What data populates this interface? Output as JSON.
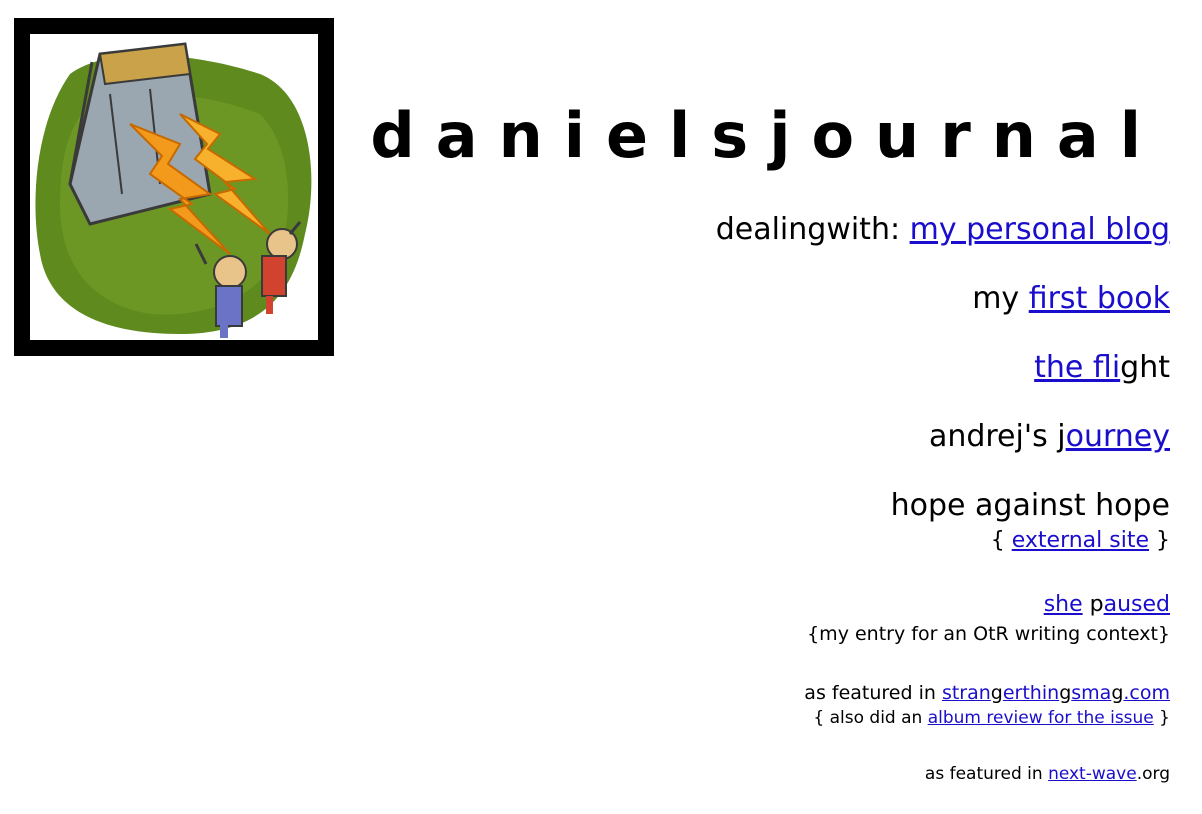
{
  "site": {
    "title": "danielsjournal"
  },
  "links": {
    "blog": {
      "prefix": "dealingwith: ",
      "link": "my personal blog"
    },
    "book": {
      "prefix": "my ",
      "link": "first book"
    },
    "flight": {
      "link": "the fli",
      "suffix": "ght"
    },
    "journey": {
      "prefix": "andrej's j",
      "link": "ourney"
    },
    "hope": {
      "title": "hope against hope",
      "open": "{ ",
      "link": "external site",
      "close": " }"
    },
    "paused": {
      "link1": "she",
      "mid": " p",
      "link2": "aused",
      "note": "{my entry for an OtR writing context}"
    },
    "strangerthings": {
      "prefix": "as featured in ",
      "seg1": "stran",
      "seg2": "g",
      "seg3": "erthin",
      "seg4": "g",
      "seg5": "sma",
      "seg6": "g",
      "seg7": ".com",
      "note_prefix": "{ also did an ",
      "note_link": "album review for the issue",
      "note_suffix": " }"
    },
    "nextwave": {
      "prefix": "as featured in ",
      "link": "next-wave",
      "suffix": ".org"
    }
  },
  "colors": {
    "link": "#1a0dcc",
    "text": "#000000",
    "background": "#ffffff"
  }
}
